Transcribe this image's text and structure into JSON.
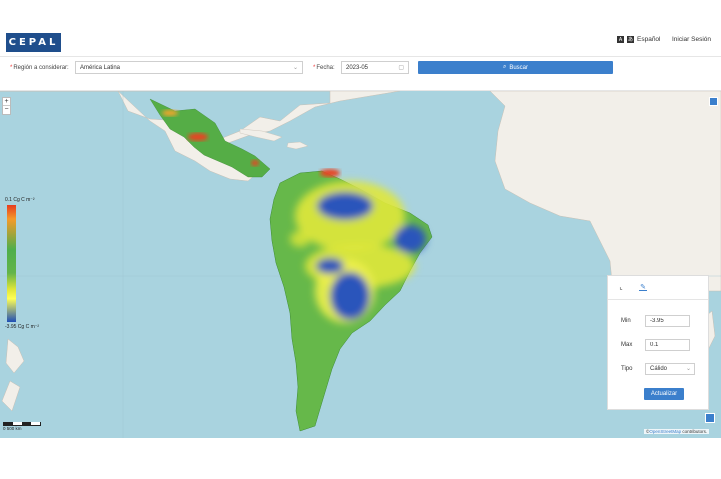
{
  "header": {
    "logo_text": "CEPAL",
    "language_label": "Español",
    "login_label": "Iniciar Sesión"
  },
  "search": {
    "region_label": "Región a considerar",
    "region_value": "América Latina",
    "date_label": "Fecha",
    "date_value": "2023-05",
    "search_label": "Buscar"
  },
  "map": {
    "zoom_in": "+",
    "zoom_out": "−",
    "legend": {
      "max_label": "0.1 Cg C m⁻²",
      "min_label": "-3.95 Cg C m⁻²"
    },
    "scale_label": "0    500 km",
    "scale_unit": "km",
    "attribution_prefix": "©",
    "attribution_link": "OpenStreetMap",
    "attribution_suffix": " contributors."
  },
  "panel": {
    "min_label": "Min",
    "min_value": "-3.95",
    "max_label": "Max",
    "max_value": "0.1",
    "type_label": "Tipo",
    "type_value": "Cálido",
    "update_label": "Actualizar"
  },
  "colors": {
    "accent": "#3b7fcc",
    "brand": "#1f4e8c",
    "ocean": "#a9d3df",
    "land": "#f2efe9",
    "high": "#e63c1f",
    "mid": "#4fae4b",
    "low_mid": "#ffff55",
    "low": "#1f4fb6"
  }
}
